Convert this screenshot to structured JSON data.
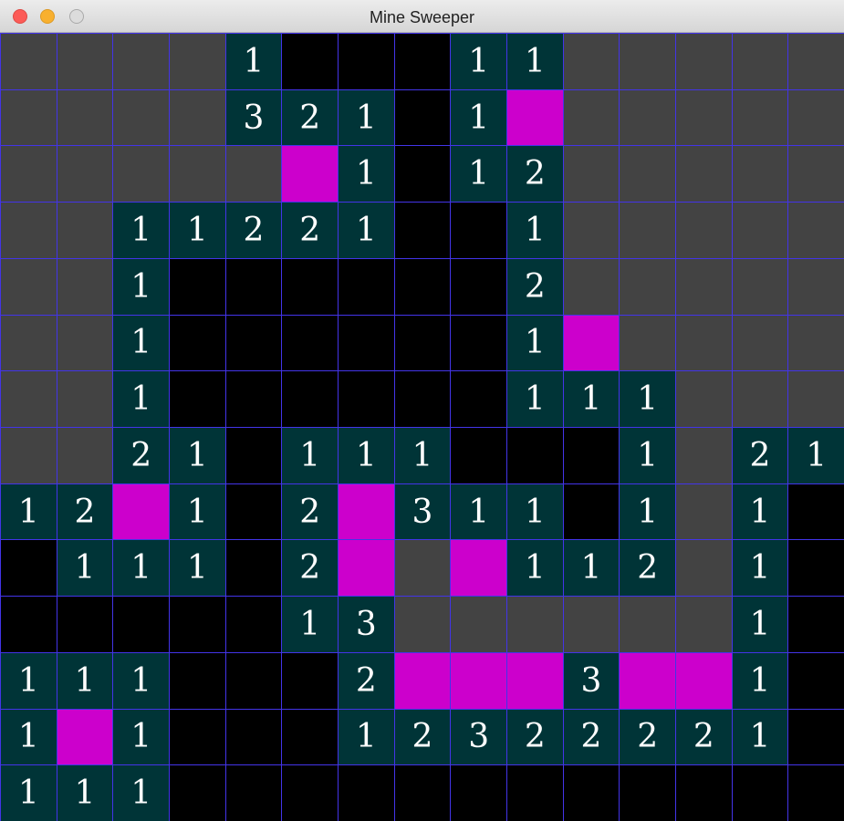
{
  "window": {
    "title": "Mine Sweeper"
  },
  "board": {
    "colors": {
      "hidden": "#434343",
      "empty": "#000000",
      "number": "#003437",
      "mine": "#cc00cc",
      "grid": "#4334e8"
    },
    "legend": {
      "H": "hidden",
      "E": "empty",
      "M": "mine",
      "1-9": "number"
    },
    "grid": [
      [
        "H",
        "H",
        "H",
        "H",
        "1",
        "E",
        "E",
        "E",
        "1",
        "1",
        "H",
        "H",
        "H",
        "H",
        "H"
      ],
      [
        "H",
        "H",
        "H",
        "H",
        "3",
        "2",
        "1",
        "E",
        "1",
        "M",
        "H",
        "H",
        "H",
        "H",
        "H"
      ],
      [
        "H",
        "H",
        "H",
        "H",
        "H",
        "M",
        "1",
        "E",
        "1",
        "2",
        "H",
        "H",
        "H",
        "H",
        "H"
      ],
      [
        "H",
        "H",
        "1",
        "1",
        "2",
        "2",
        "1",
        "E",
        "E",
        "1",
        "H",
        "H",
        "H",
        "H",
        "H"
      ],
      [
        "H",
        "H",
        "1",
        "E",
        "E",
        "E",
        "E",
        "E",
        "E",
        "2",
        "H",
        "H",
        "H",
        "H",
        "H"
      ],
      [
        "H",
        "H",
        "1",
        "E",
        "E",
        "E",
        "E",
        "E",
        "E",
        "1",
        "M",
        "H",
        "H",
        "H",
        "H"
      ],
      [
        "H",
        "H",
        "1",
        "E",
        "E",
        "E",
        "E",
        "E",
        "E",
        "1",
        "1",
        "1",
        "H",
        "H",
        "H"
      ],
      [
        "H",
        "H",
        "2",
        "1",
        "E",
        "1",
        "1",
        "1",
        "E",
        "E",
        "E",
        "1",
        "H",
        "2",
        "1"
      ],
      [
        "1",
        "2",
        "M",
        "1",
        "E",
        "2",
        "M",
        "3",
        "1",
        "1",
        "E",
        "1",
        "H",
        "1",
        "E"
      ],
      [
        "E",
        "1",
        "1",
        "1",
        "E",
        "2",
        "M",
        "H",
        "M",
        "1",
        "1",
        "2",
        "H",
        "1",
        "E"
      ],
      [
        "E",
        "E",
        "E",
        "E",
        "E",
        "1",
        "3",
        "H",
        "H",
        "H",
        "H",
        "H",
        "H",
        "1",
        "E"
      ],
      [
        "1",
        "1",
        "1",
        "E",
        "E",
        "E",
        "2",
        "M",
        "M",
        "M",
        "3",
        "M",
        "M",
        "1",
        "E"
      ],
      [
        "1",
        "M",
        "1",
        "E",
        "E",
        "E",
        "1",
        "2",
        "3",
        "2",
        "2",
        "2",
        "2",
        "1",
        "E"
      ],
      [
        "1",
        "1",
        "1",
        "E",
        "E",
        "E",
        "E",
        "E",
        "E",
        "E",
        "E",
        "E",
        "E",
        "E",
        "E"
      ]
    ]
  }
}
